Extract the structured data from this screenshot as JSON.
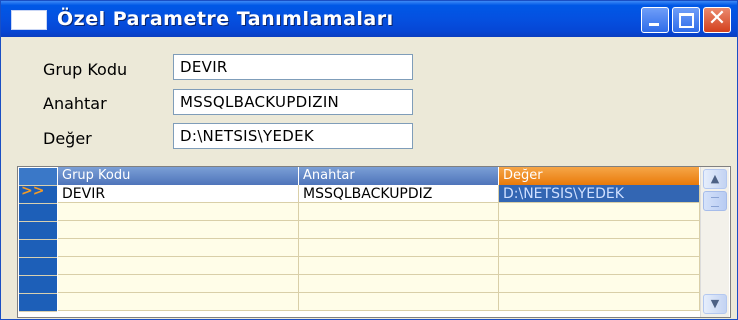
{
  "window": {
    "title": "Özel Parametre Tanımlamaları"
  },
  "form": {
    "fields": [
      {
        "label": "Grup Kodu",
        "value": "DEVIR"
      },
      {
        "label": "Anahtar",
        "value": "MSSQLBACKUPDIZIN"
      },
      {
        "label": "Değer",
        "value": "D:\\NETSIS\\YEDEK"
      }
    ]
  },
  "grid": {
    "columns": [
      "Grup Kodu",
      "Anahtar",
      "Değer"
    ],
    "rows": [
      {
        "indicator": ">>",
        "grup_kodu": "DEVIR",
        "anahtar": "MSSQLBACKUPDIZ",
        "deger": "D:\\NETSIS\\YEDEK"
      }
    ]
  },
  "colors": {
    "title_bar": "#0550e0",
    "active_column": "#e97a0a",
    "indicator": "#1d5fb8"
  }
}
